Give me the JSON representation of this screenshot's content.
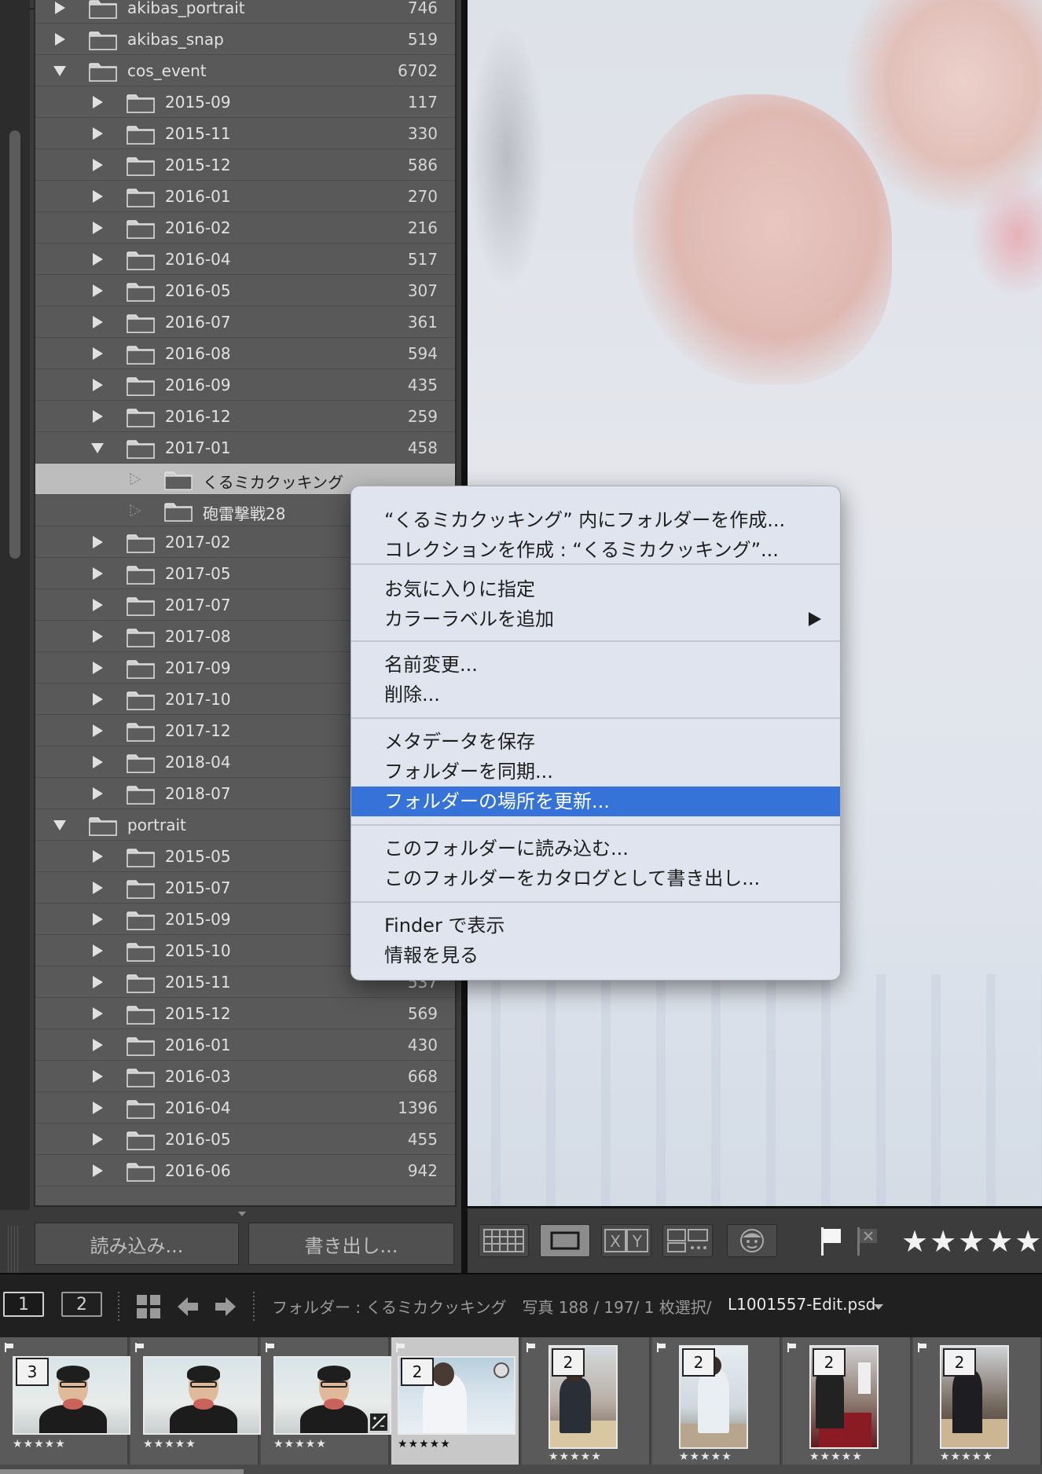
{
  "folders": {
    "rows": [
      {
        "name": "akibas_portrait",
        "count": "746"
      },
      {
        "name": "akibas_snap",
        "count": "519"
      },
      {
        "name": "cos_event",
        "count": "6702"
      },
      {
        "name": "2015-09",
        "count": "117"
      },
      {
        "name": "2015-11",
        "count": "330"
      },
      {
        "name": "2015-12",
        "count": "586"
      },
      {
        "name": "2016-01",
        "count": "270"
      },
      {
        "name": "2016-02",
        "count": "216"
      },
      {
        "name": "2016-04",
        "count": "517"
      },
      {
        "name": "2016-05",
        "count": "307"
      },
      {
        "name": "2016-07",
        "count": "361"
      },
      {
        "name": "2016-08",
        "count": "594"
      },
      {
        "name": "2016-09",
        "count": "435"
      },
      {
        "name": "2016-12",
        "count": "259"
      },
      {
        "name": "2017-01",
        "count": "458"
      },
      {
        "name": "くるミカクッキング",
        "count": ""
      },
      {
        "name": "砲雷撃戦28",
        "count": ""
      },
      {
        "name": "2017-02",
        "count": ""
      },
      {
        "name": "2017-05",
        "count": ""
      },
      {
        "name": "2017-07",
        "count": ""
      },
      {
        "name": "2017-08",
        "count": ""
      },
      {
        "name": "2017-09",
        "count": ""
      },
      {
        "name": "2017-10",
        "count": ""
      },
      {
        "name": "2017-12",
        "count": ""
      },
      {
        "name": "2018-04",
        "count": ""
      },
      {
        "name": "2018-07",
        "count": ""
      },
      {
        "name": "portrait",
        "count": ""
      },
      {
        "name": "2015-05",
        "count": ""
      },
      {
        "name": "2015-07",
        "count": ""
      },
      {
        "name": "2015-09",
        "count": ""
      },
      {
        "name": "2015-10",
        "count": ""
      },
      {
        "name": "2015-11",
        "count": "537"
      },
      {
        "name": "2015-12",
        "count": "569"
      },
      {
        "name": "2016-01",
        "count": "430"
      },
      {
        "name": "2016-03",
        "count": "668"
      },
      {
        "name": "2016-04",
        "count": "1396"
      },
      {
        "name": "2016-05",
        "count": "455"
      },
      {
        "name": "2016-06",
        "count": "942"
      }
    ]
  },
  "panel_buttons": {
    "import_label": "読み込み...",
    "export_label": "書き出し..."
  },
  "context_menu": {
    "items": [
      "“くるミカクッキング” 内にフォルダーを作成...",
      "コレクションを作成 : “くるミカクッキング”...",
      "お気に入りに指定",
      "カラーラベルを追加",
      "名前変更...",
      "削除...",
      "メタデータを保存",
      "フォルダーを同期...",
      "フォルダーの場所を更新...",
      "このフォルダーに読み込む...",
      "このフォルダーをカタログとして書き出し...",
      "Finder で表示",
      "情報を見る"
    ],
    "highlighted_index": 8,
    "highlight_color": "#3573d9"
  },
  "toolbar": {
    "stars": "★★★★★",
    "icons": [
      "grid-view-icon",
      "loupe-view-icon",
      "compare-view-icon",
      "survey-view-icon",
      "people-view-icon",
      "flag-icon",
      "reject-flag-icon"
    ]
  },
  "filmbar": {
    "screen1": "1",
    "screen2": "2",
    "status": "フォルダー : くるミカクッキング　写真 188 / 197/ 1 枚選択/",
    "filename": "L1001557-Edit.psd"
  },
  "filmstrip": {
    "cells": [
      {
        "badge": "3",
        "stars": "★★★★★"
      },
      {
        "badge": "",
        "stars": "★★★★★"
      },
      {
        "badge": "",
        "stars": "★★★★★"
      },
      {
        "badge": "2",
        "stars": "★★★★★"
      },
      {
        "badge": "2",
        "stars": "★★★★★"
      },
      {
        "badge": "2",
        "stars": "★★★★★"
      },
      {
        "badge": "2",
        "stars": "★★★★★"
      },
      {
        "badge": "2",
        "stars": "★★★★★"
      }
    ],
    "selected_index": 3
  }
}
